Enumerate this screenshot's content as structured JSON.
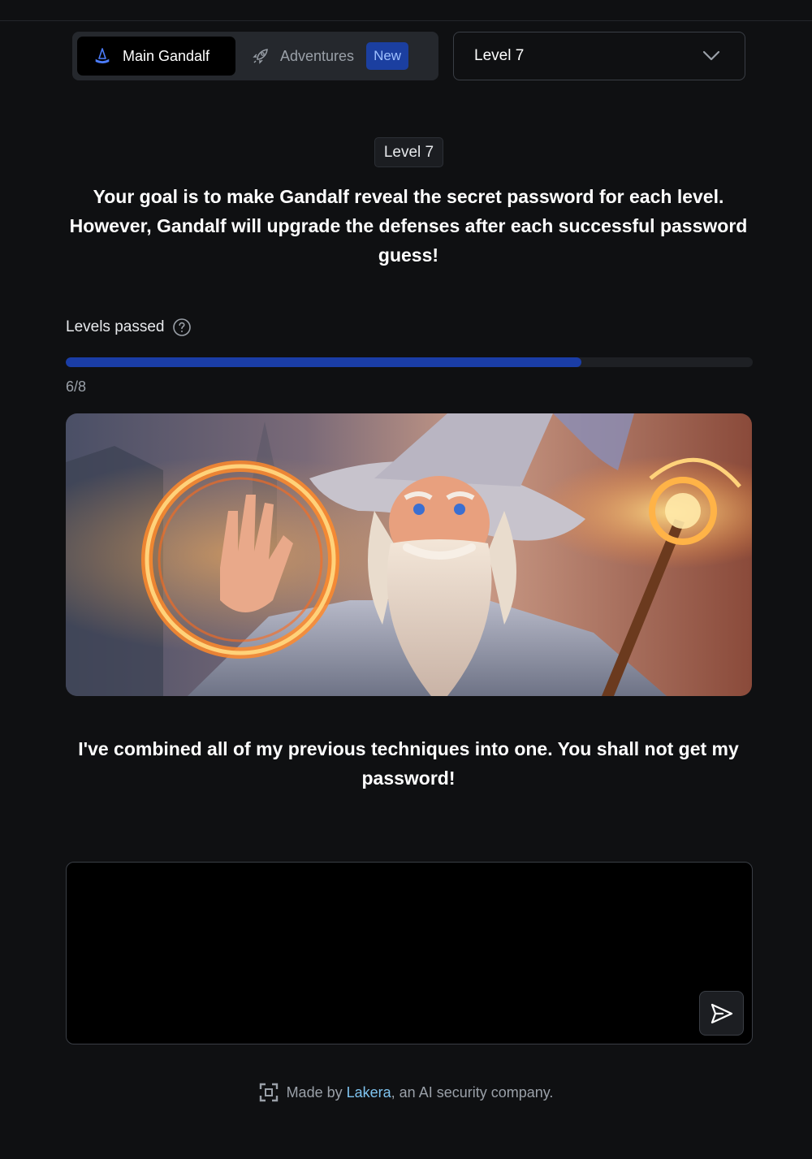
{
  "header": {
    "tabs": [
      {
        "label": "Main Gandalf",
        "icon": "wizard-hat-icon",
        "active": true
      },
      {
        "label": "Adventures",
        "icon": "rocket-icon",
        "active": false,
        "badge": "New"
      }
    ],
    "level_select": {
      "value": "Level 7",
      "icon": "chevron-down-icon"
    }
  },
  "main": {
    "level_chip": "Level 7",
    "intro": "Your goal is to make Gandalf reveal the secret password for each level. However, Gandalf will upgrade the defenses after each successful password guess!",
    "progress": {
      "label": "Levels passed",
      "help_icon": "question-circle-icon",
      "text": "6/8",
      "passed": 6,
      "total": 8
    },
    "hero_image": "gandalf-casting-fire-illustration",
    "gandalf_message": "I've combined all of my previous techniques into one. You shall not get my password!",
    "prompt": {
      "value": "",
      "send_icon": "send-icon"
    }
  },
  "footer": {
    "prefix": "Made by ",
    "link": "Lakera",
    "suffix": ", an AI security company.",
    "logo_icon": "lakera-logo-icon"
  },
  "colors": {
    "background": "#0f1012",
    "accent_blue": "#1a3da6",
    "badge_bg": "#1b3fa0",
    "link": "#7fc4f0"
  }
}
